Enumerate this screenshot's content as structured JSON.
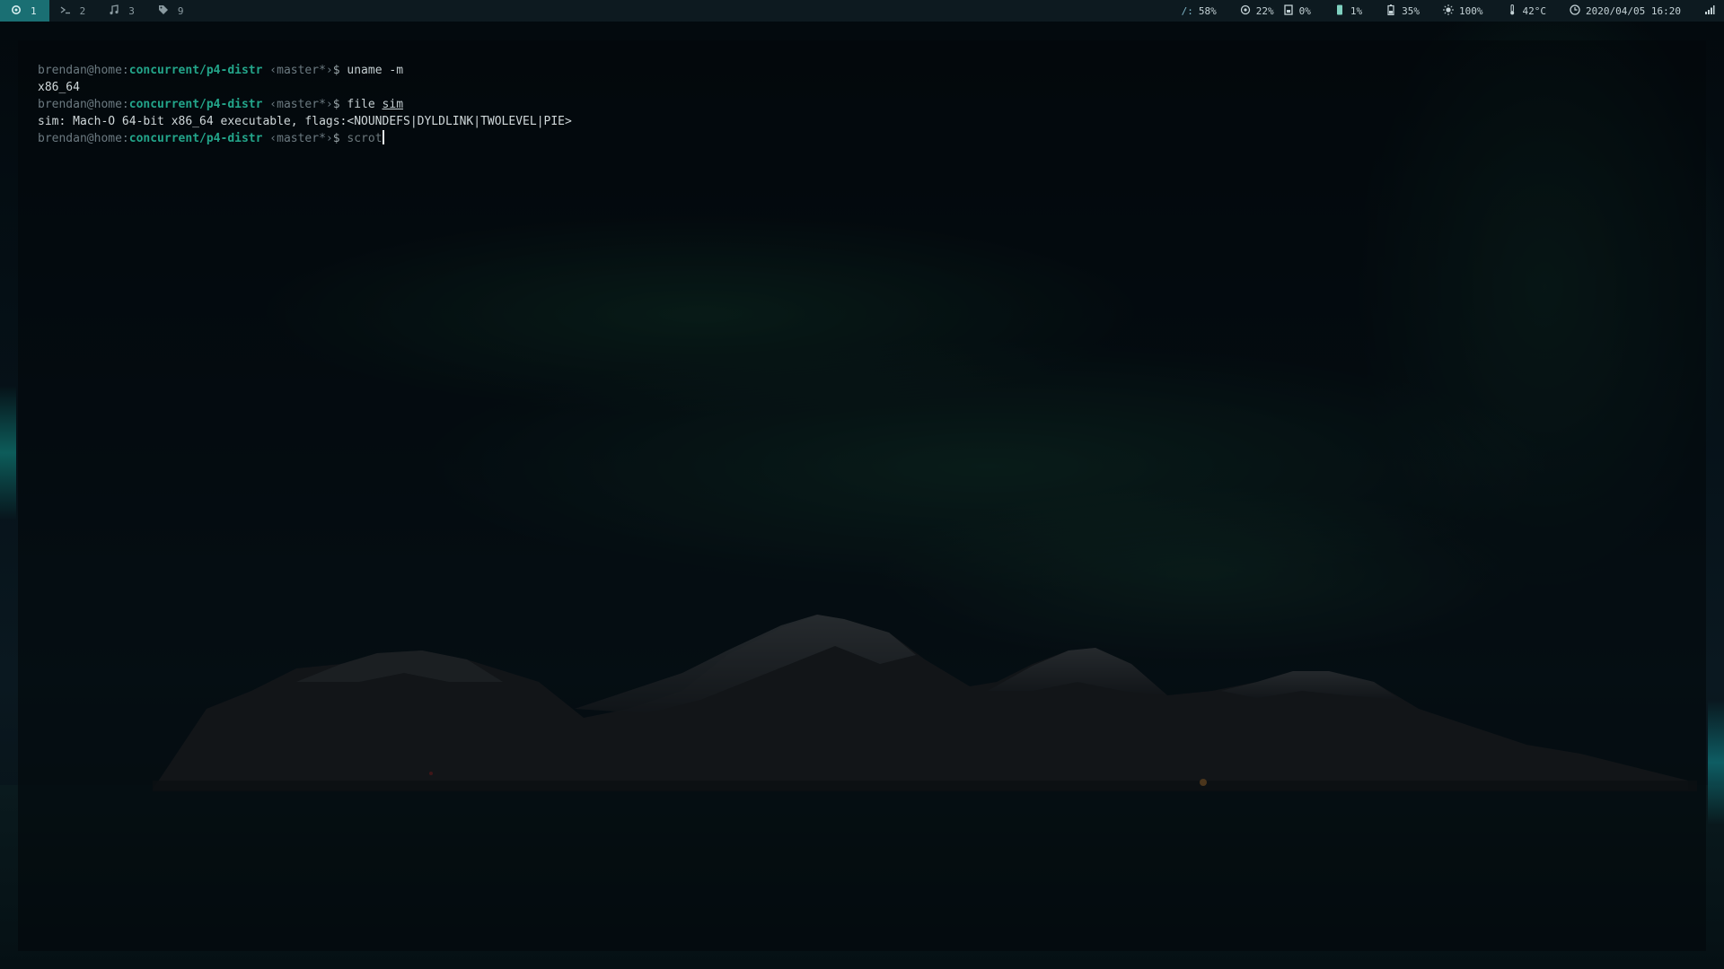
{
  "topbar": {
    "workspaces": [
      {
        "icon": "gear-icon",
        "number": "1",
        "active": true
      },
      {
        "icon": "terminal-icon",
        "number": "2",
        "active": false
      },
      {
        "icon": "music-note-icon",
        "number": "3",
        "active": false
      },
      {
        "icon": "tag-icon",
        "number": "9",
        "active": false
      }
    ],
    "status": {
      "disk_label": "/:",
      "disk_value": "58%",
      "cpu_value": "22%",
      "mem_value": "0%",
      "gpu_value": "1%",
      "battery_value": "35%",
      "brightness_value": "100%",
      "temperature_value": "42°C",
      "datetime": "2020/04/05 16:20"
    }
  },
  "terminal": {
    "prompt_user": "brendan@home:",
    "prompt_path": "concurrent/p4-distr",
    "prompt_branch": "‹master*›",
    "prompt_dollar": "$",
    "lines": {
      "cmd1": "uname -m",
      "out1": "x86_64",
      "cmd2_prefix": "file ",
      "cmd2_arg": "sim",
      "out2": "sim: Mach-O 64-bit x86_64 executable, flags:<NOUNDEFS|DYLDLINK|TWOLEVEL|PIE>",
      "cmd3": "scrot"
    }
  },
  "colors": {
    "accent": "#1a6f73",
    "prompt_path": "#23a58a",
    "topbar_bg": "#0d1a20"
  }
}
